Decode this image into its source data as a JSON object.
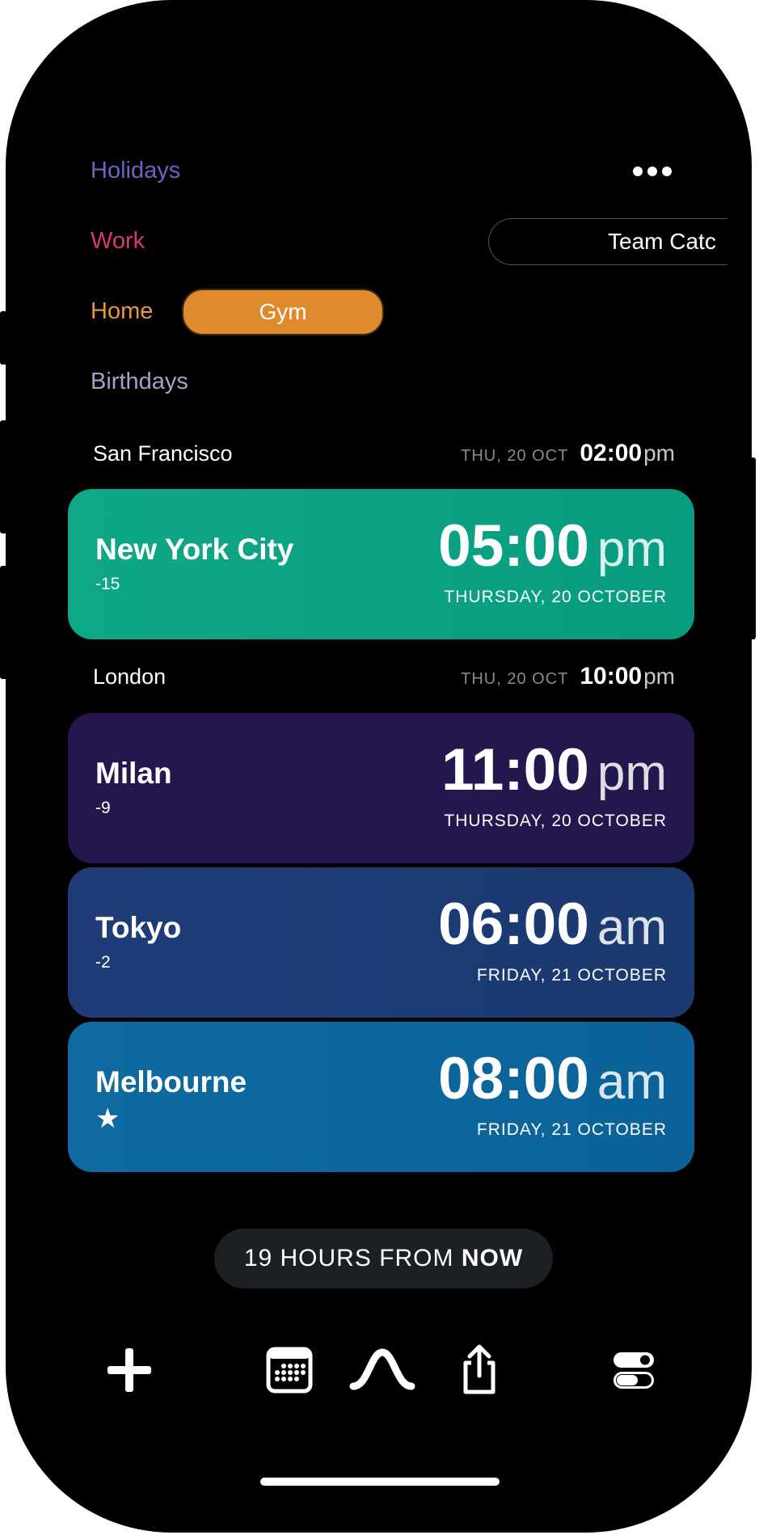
{
  "calendars": [
    {
      "label": "Holidays",
      "color": "#6b64c4"
    },
    {
      "label": "Work",
      "color": "#d63c6b"
    },
    {
      "label": "Home",
      "color": "#e8973a"
    },
    {
      "label": "Birthdays",
      "color": "#9aa6c9"
    }
  ],
  "events": {
    "work_event": "Team Catc",
    "home_event": "Gym"
  },
  "reference_rows": [
    {
      "city": "San Francisco",
      "date": "THU, 20 OCT",
      "time": "02:00",
      "ampm": "pm"
    },
    {
      "city": "London",
      "date": "THU, 20 OCT",
      "time": "10:00",
      "ampm": "pm"
    }
  ],
  "cards": [
    {
      "city": "New York City",
      "offset": "-15",
      "time": "05:00",
      "ampm": "pm",
      "date": "THURSDAY, 20 OCTOBER",
      "color": "#0aa47f"
    },
    {
      "city": "Milan",
      "offset": "-9",
      "time": "11:00",
      "ampm": "pm",
      "date": "THURSDAY, 20 OCTOBER",
      "color": "#23174d"
    },
    {
      "city": "Tokyo",
      "offset": "-2",
      "time": "06:00",
      "ampm": "am",
      "date": "FRIDAY, 21 OCTOBER",
      "color": "#1d3a74"
    },
    {
      "city": "Melbourne",
      "offset": "★",
      "time": "08:00",
      "ampm": "am",
      "date": "FRIDAY, 21 OCTOBER",
      "color": "#0e679c"
    }
  ],
  "time_offset": {
    "prefix": "19 HOURS FROM ",
    "emphasis": "NOW"
  },
  "toolbar": {
    "icons": [
      "plus-icon",
      "calendar-icon",
      "wave-icon",
      "share-icon",
      "toggles-icon"
    ]
  }
}
